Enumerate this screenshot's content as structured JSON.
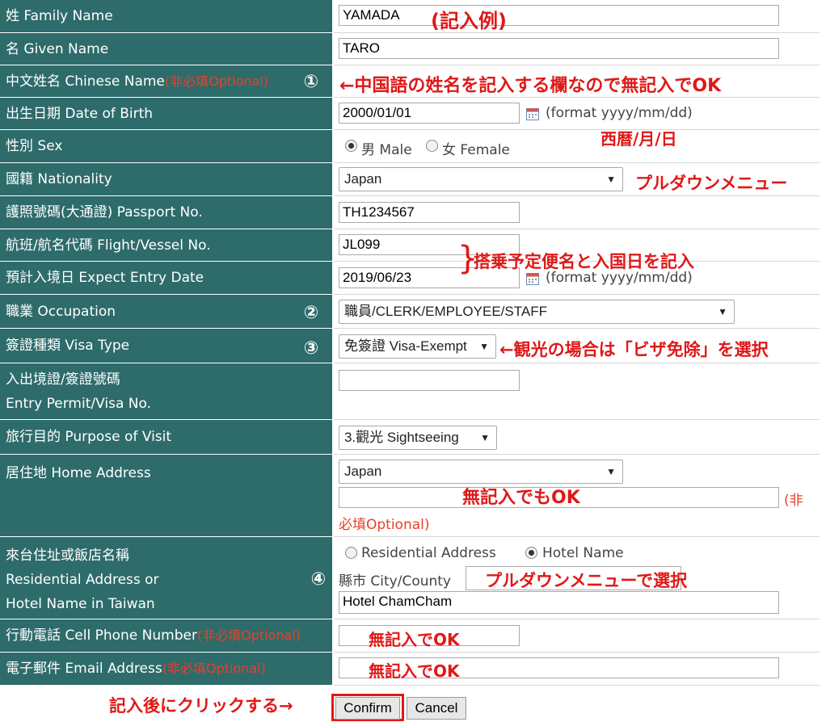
{
  "rows": {
    "family_name": {
      "label": "姓 Family Name",
      "value": "YAMADA"
    },
    "given_name": {
      "label": "名 Given Name",
      "value": "TARO"
    },
    "chinese_name": {
      "label": "中文姓名 Chinese Name",
      "optional": "(非必填Optional)",
      "marker": "①"
    },
    "dob": {
      "label": "出生日期 Date of Birth",
      "value": "2000/01/01",
      "format": "(format yyyy/mm/dd)"
    },
    "sex": {
      "label": "性別 Sex",
      "male": "男 Male",
      "female": "女 Female",
      "selected": "male"
    },
    "nationality": {
      "label": "國籍 Nationality",
      "value": "Japan"
    },
    "passport": {
      "label": "護照號碼(大通證) Passport No.",
      "value": "TH1234567"
    },
    "flight": {
      "label": "航班/航名代碼 Flight/Vessel No.",
      "value": "JL099"
    },
    "entry_date": {
      "label": "預計入境日 Expect Entry Date",
      "value": "2019/06/23",
      "format": "(format yyyy/mm/dd)"
    },
    "occupation": {
      "label": "職業 Occupation",
      "value": "職員/CLERK/EMPLOYEE/STAFF",
      "marker": "②"
    },
    "visa_type": {
      "label": "簽證種類 Visa Type",
      "value": "免簽證 Visa-Exempt",
      "marker": "③"
    },
    "entry_permit": {
      "label1": "入出境證/簽證號碼",
      "label2": "Entry Permit/Visa No.",
      "value": ""
    },
    "purpose": {
      "label": "旅行目的 Purpose of Visit",
      "value": "3.觀光 Sightseeing"
    },
    "home_address": {
      "label": "居住地 Home Address",
      "country": "Japan",
      "address": "",
      "optional_a": "(非",
      "optional_b": "必填Optional)"
    },
    "taiwan_address": {
      "label1": "來台住址或飯店名稱",
      "label2": "Residential Address or",
      "label3": "Hotel Name in Taiwan",
      "marker": "④",
      "opt_residential": "Residential Address",
      "opt_hotel": "Hotel Name",
      "selected": "hotel",
      "city_label": "縣市 City/County",
      "city_value": "",
      "hotel_value": "Hotel ChamCham"
    },
    "cell_phone": {
      "label": "行動電話 Cell Phone Number",
      "optional": "(非必填Optional)",
      "value": ""
    },
    "email": {
      "label": "電子郵件 Email Address",
      "optional": "(非必填Optional)",
      "value": ""
    }
  },
  "buttons": {
    "confirm": "Confirm",
    "cancel": "Cancel"
  },
  "annotations": {
    "example": "(記入例)",
    "chinese_name_note": "←中国語の姓名を記入する欄なので無記入でOK",
    "dob_note": "西暦/月/日",
    "nationality_note": "プルダウンメニュー",
    "flight_note": "搭乗予定便名と入国日を記入",
    "visa_note": "←観光の場合は「ビザ免除」を選択",
    "home_note": "無記入でもOK",
    "city_note": "プルダウンメニューで選択",
    "phone_note": "無記入でOK",
    "email_note": "無記入でOK",
    "confirm_note": "記入後にクリックする→"
  },
  "icons": {
    "calendar": "calendar-icon",
    "dropdown": "dropdown-arrow-icon"
  },
  "colors": {
    "label_bg": "#2e6b6b",
    "annotation": "#e01818",
    "optional": "#e8402a"
  }
}
